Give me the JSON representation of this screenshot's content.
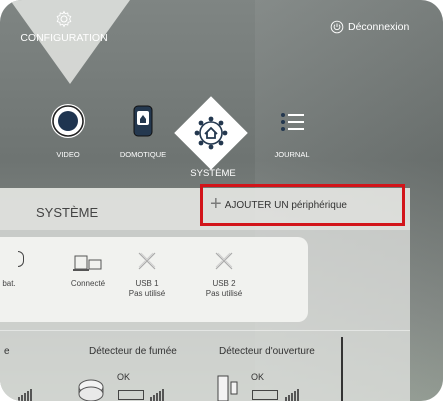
{
  "header": {
    "configuration_label": "CONFIGURATION",
    "logout_label": "Déconnexion"
  },
  "nav": {
    "video": "VIDEO",
    "domotique": "DOMOTIQUE",
    "systeme": "SYSTÈME",
    "journal": "JOURNAL"
  },
  "panel": {
    "title": "SYSTÈME",
    "add_button": "AJOUTER UN périphérique"
  },
  "status_cards": [
    {
      "label": "bat."
    },
    {
      "label": "Connecté"
    },
    {
      "label": "USB 1",
      "sub": "Pas utilisé"
    },
    {
      "label": "USB 2",
      "sub": "Pas utilisé"
    }
  ],
  "detectors": {
    "partial_left": "e",
    "smoke_label": "Détecteur de fumée",
    "opening_label": "Détecteur d'ouverture",
    "smoke_status": "OK",
    "opening_status": "OK"
  },
  "icons": {
    "configuration": "gear-icon",
    "logout": "power-icon",
    "video": "record-icon",
    "domotique": "home-device-icon",
    "systeme": "network-icon",
    "journal": "list-icon"
  },
  "colors": {
    "highlight": "#d2141a",
    "nav_text": "#ffffff"
  }
}
